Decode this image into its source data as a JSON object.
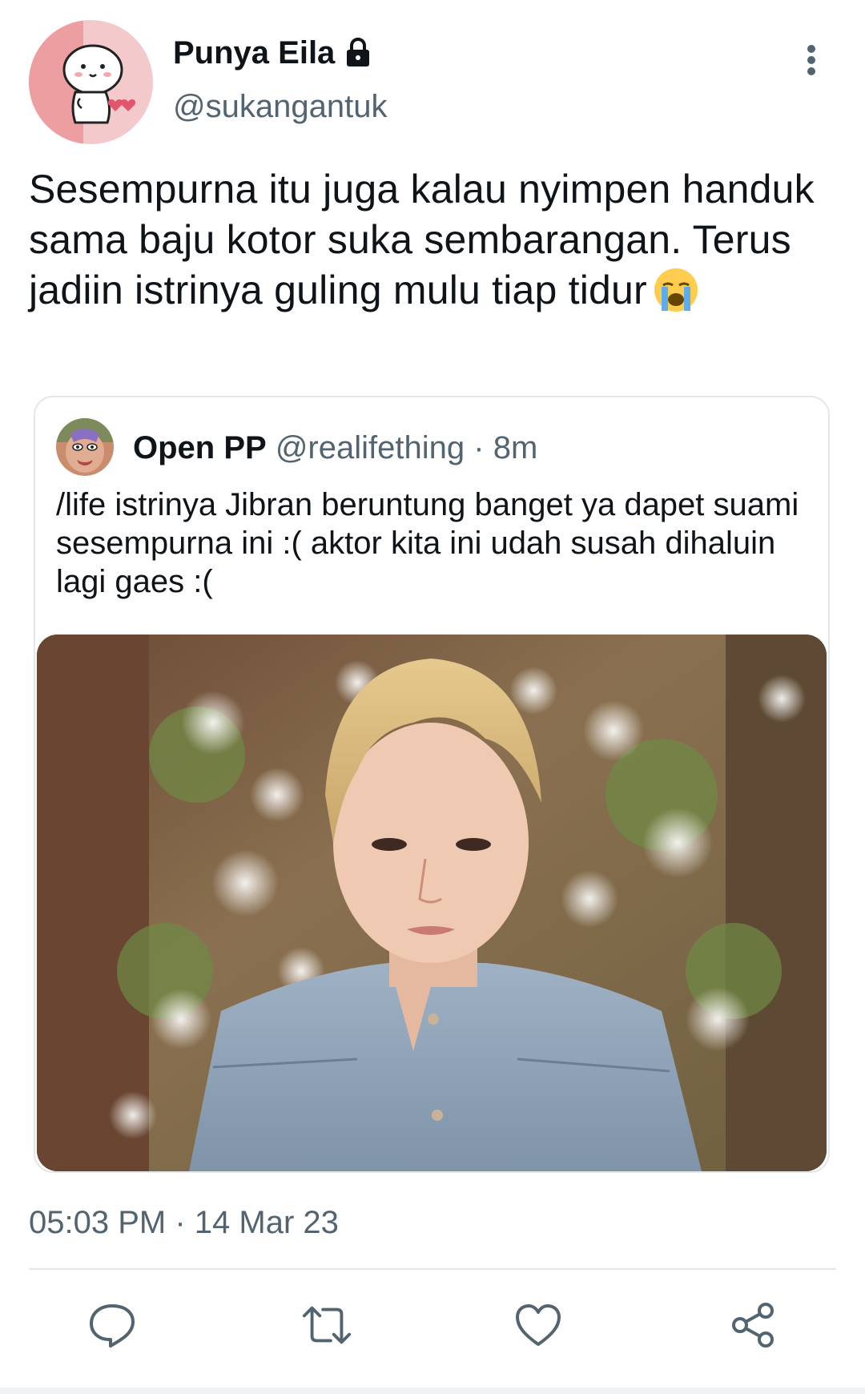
{
  "author": {
    "display_name": "Punya Eila",
    "handle": "@sukangantuk",
    "protected_icon": "lock-icon"
  },
  "tweet": {
    "text": "Sesempurna itu juga kalau nyimpen handuk sama baju kotor suka sembarangan. Terus jadiin istrinya guling mulu tiap tidur",
    "emoji": "loudly-crying-face"
  },
  "quoted_tweet": {
    "display_name": "Open PP",
    "handle": "@realifething",
    "separator": "·",
    "time": "8m",
    "text": "/life istrinya Jibran beruntung banget ya dapet suami sesempurna ini :( aktor kita ini udah susah dihaluin lagi gaes :("
  },
  "meta": {
    "time": "05:03 PM",
    "separator": "·",
    "date": "14 Mar 23"
  },
  "actions": [
    {
      "name": "reply",
      "icon": "comment-icon"
    },
    {
      "name": "retweet",
      "icon": "retweet-icon"
    },
    {
      "name": "like",
      "icon": "heart-icon"
    },
    {
      "name": "share",
      "icon": "share-icon"
    }
  ],
  "colors": {
    "text_primary": "#0f1419",
    "text_secondary": "#536471",
    "border": "#e3e7ea",
    "icon": "#536471"
  }
}
